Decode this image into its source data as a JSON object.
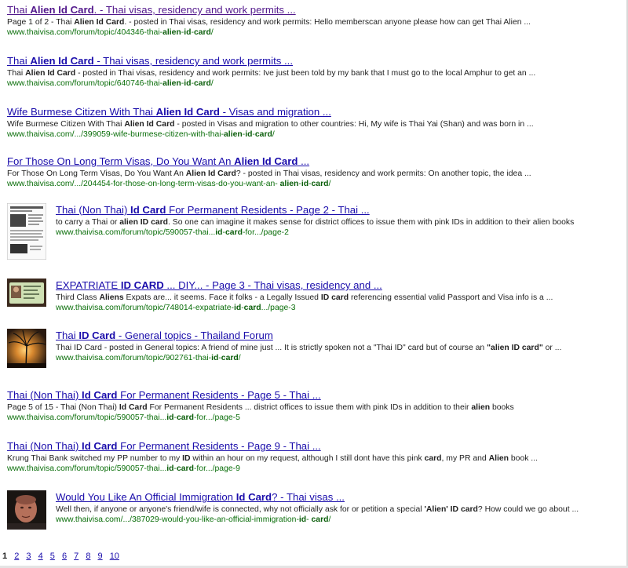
{
  "results": [
    {
      "title": [
        {
          "t": "Thai ",
          "b": false
        },
        {
          "t": "Alien Id Card",
          "b": true
        },
        {
          "t": ". - Thai visas, residency and work permits ...",
          "b": false
        }
      ],
      "visited": true,
      "snippet": [
        {
          "t": "Page 1 of 2 - Thai ",
          "b": false
        },
        {
          "t": "Alien Id Card",
          "b": true
        },
        {
          "t": ". - posted in Thai visas, residency and work permits: Hello memberscan anyone please how can get Thai Alien ...",
          "b": false
        }
      ],
      "url": [
        {
          "t": "www.thaivisa.com/forum/topic/404346-thai-",
          "b": false
        },
        {
          "t": "alien",
          "b": true
        },
        {
          "t": "-",
          "b": false
        },
        {
          "t": "id",
          "b": true
        },
        {
          "t": "-",
          "b": false
        },
        {
          "t": "card",
          "b": true
        },
        {
          "t": "/",
          "b": false
        }
      ]
    },
    {
      "title": [
        {
          "t": "Thai ",
          "b": false
        },
        {
          "t": "Alien Id Card",
          "b": true
        },
        {
          "t": " - Thai visas, residency and work permits ...",
          "b": false
        }
      ],
      "visited": false,
      "snippet": [
        {
          "t": "Thai ",
          "b": false
        },
        {
          "t": "Alien Id Card",
          "b": true
        },
        {
          "t": " - posted in Thai visas, residency and work permits: Ive just been told by my bank that I must go to the local Amphur to get an ...",
          "b": false
        }
      ],
      "url": [
        {
          "t": "www.thaivisa.com/forum/topic/640746-thai-",
          "b": false
        },
        {
          "t": "alien",
          "b": true
        },
        {
          "t": "-",
          "b": false
        },
        {
          "t": "id",
          "b": true
        },
        {
          "t": "-",
          "b": false
        },
        {
          "t": "card",
          "b": true
        },
        {
          "t": "/",
          "b": false
        }
      ]
    },
    {
      "title": [
        {
          "t": "Wife Burmese Citizen With Thai ",
          "b": false
        },
        {
          "t": "Alien Id Card",
          "b": true
        },
        {
          "t": " - Visas and migration ...",
          "b": false
        }
      ],
      "visited": false,
      "snippet": [
        {
          "t": "Wife Burmese Citizen With Thai ",
          "b": false
        },
        {
          "t": "Alien Id Card",
          "b": true
        },
        {
          "t": " - posted in Visas and migration to other countries: Hi, My wife is Thai Yai (Shan) and was born in ...",
          "b": false
        }
      ],
      "url": [
        {
          "t": "www.thaivisa.com/.../399059-wife-burmese-citizen-with-thai-",
          "b": false
        },
        {
          "t": "alien",
          "b": true
        },
        {
          "t": "-",
          "b": false
        },
        {
          "t": "id",
          "b": true
        },
        {
          "t": "-",
          "b": false
        },
        {
          "t": "card",
          "b": true
        },
        {
          "t": "/",
          "b": false
        }
      ]
    },
    {
      "title": [
        {
          "t": "For Those On Long Term Visas, Do You Want An ",
          "b": false
        },
        {
          "t": "Alien Id Card",
          "b": true
        },
        {
          "t": " ...",
          "b": false
        }
      ],
      "visited": false,
      "snippet": [
        {
          "t": "For Those On Long Term Visas, Do You Want An ",
          "b": false
        },
        {
          "t": "Alien Id Card",
          "b": true
        },
        {
          "t": "? - posted in Thai visas, residency and work permits: On another topic, the idea ...",
          "b": false
        }
      ],
      "url": [
        {
          "t": "www.thaivisa.com/.../204454-for-those-on-long-term-visas-do-you-want-an- ",
          "b": false
        },
        {
          "t": "alien",
          "b": true
        },
        {
          "t": "-",
          "b": false
        },
        {
          "t": "id",
          "b": true
        },
        {
          "t": "-",
          "b": false
        },
        {
          "t": "card",
          "b": true
        },
        {
          "t": "/",
          "b": false
        }
      ]
    },
    {
      "thumb": "document",
      "title": [
        {
          "t": "Thai (Non Thai) ",
          "b": false
        },
        {
          "t": "Id Card",
          "b": true
        },
        {
          "t": " For Permanent Residents - Page 2 - Thai ...",
          "b": false
        }
      ],
      "visited": false,
      "snippet": [
        {
          "t": "to carry a Thai or ",
          "b": false
        },
        {
          "t": "alien ID card",
          "b": true
        },
        {
          "t": ". So one can imagine it makes sense for district offices to issue them with pink IDs in addition to their alien books",
          "b": false
        }
      ],
      "url": [
        {
          "t": "www.thaivisa.com/forum/topic/590057-thai...",
          "b": false
        },
        {
          "t": "id",
          "b": true
        },
        {
          "t": "-",
          "b": false
        },
        {
          "t": "card",
          "b": true
        },
        {
          "t": "-for.../page-2",
          "b": false
        }
      ]
    },
    {
      "thumb": "idcard",
      "title": [
        {
          "t": "EXPATRIATE ",
          "b": false
        },
        {
          "t": "ID CARD",
          "b": true
        },
        {
          "t": " ... DIY... - Page 3 - Thai visas, residency and ...",
          "b": false
        }
      ],
      "visited": false,
      "snippet": [
        {
          "t": "Third Class ",
          "b": false
        },
        {
          "t": "Aliens",
          "b": true
        },
        {
          "t": " Expats are... it seems. Face it folks - a Legally Issued ",
          "b": false
        },
        {
          "t": "ID card",
          "b": true
        },
        {
          "t": " referencing essential valid Passport and Visa info is a ...",
          "b": false
        }
      ],
      "url": [
        {
          "t": "www.thaivisa.com/forum/topic/748014-expatriate-",
          "b": false
        },
        {
          "t": "id",
          "b": true
        },
        {
          "t": "-",
          "b": false
        },
        {
          "t": "card",
          "b": true
        },
        {
          "t": ".../page-3",
          "b": false
        }
      ]
    },
    {
      "thumb": "sunset",
      "title": [
        {
          "t": "Thai ",
          "b": false
        },
        {
          "t": "ID Card",
          "b": true
        },
        {
          "t": " - General topics - Thailand Forum",
          "b": false
        }
      ],
      "visited": false,
      "snippet": [
        {
          "t": "Thai ID Card - posted in General topics: A friend of mine just ... It is strictly spoken not a \"Thai ID\" card but of course an ",
          "b": false
        },
        {
          "t": "\"alien ID card\"",
          "b": true
        },
        {
          "t": " or ...",
          "b": false
        }
      ],
      "url": [
        {
          "t": "www.thaivisa.com/forum/topic/902761-thai-",
          "b": false
        },
        {
          "t": "id",
          "b": true
        },
        {
          "t": "-",
          "b": false
        },
        {
          "t": "card",
          "b": true
        },
        {
          "t": "/",
          "b": false
        }
      ]
    },
    {
      "title": [
        {
          "t": "Thai (Non Thai) ",
          "b": false
        },
        {
          "t": "Id Card",
          "b": true
        },
        {
          "t": " For Permanent Residents - Page 5 - Thai ...",
          "b": false
        }
      ],
      "visited": false,
      "snippet": [
        {
          "t": "Page 5 of 15 - Thai (Non Thai) ",
          "b": false
        },
        {
          "t": "Id Card",
          "b": true
        },
        {
          "t": " For Permanent Residents ... district offices to issue them with pink IDs in addition to their ",
          "b": false
        },
        {
          "t": "alien",
          "b": true
        },
        {
          "t": " books",
          "b": false
        }
      ],
      "url": [
        {
          "t": "www.thaivisa.com/forum/topic/590057-thai...",
          "b": false
        },
        {
          "t": "id",
          "b": true
        },
        {
          "t": "-",
          "b": false
        },
        {
          "t": "card",
          "b": true
        },
        {
          "t": "-for.../page-5",
          "b": false
        }
      ]
    },
    {
      "title": [
        {
          "t": "Thai (Non Thai) ",
          "b": false
        },
        {
          "t": "Id Card",
          "b": true
        },
        {
          "t": " For Permanent Residents - Page 9 - Thai ...",
          "b": false
        }
      ],
      "visited": false,
      "snippet": [
        {
          "t": "Krung Thai Bank switched my PP number to my ",
          "b": false
        },
        {
          "t": "ID",
          "b": true
        },
        {
          "t": " within an hour on my request, although I still dont have this pink ",
          "b": false
        },
        {
          "t": "card",
          "b": true
        },
        {
          "t": ", my PR and ",
          "b": false
        },
        {
          "t": "Alien",
          "b": true
        },
        {
          "t": " book ...",
          "b": false
        }
      ],
      "url": [
        {
          "t": "www.thaivisa.com/forum/topic/590057-thai...",
          "b": false
        },
        {
          "t": "id",
          "b": true
        },
        {
          "t": "-",
          "b": false
        },
        {
          "t": "card",
          "b": true
        },
        {
          "t": "-for.../page-9",
          "b": false
        }
      ]
    },
    {
      "thumb": "portrait",
      "title": [
        {
          "t": "Would You Like An Official Immigration ",
          "b": false
        },
        {
          "t": "Id Card",
          "b": true
        },
        {
          "t": "? - Thai visas ...",
          "b": false
        }
      ],
      "visited": false,
      "snippet": [
        {
          "t": "Well then, if anyone or anyone's friend/wife is connected, why not officially ask for or petition a special ",
          "b": false
        },
        {
          "t": "'Alien' ID card",
          "b": true
        },
        {
          "t": "? How could we go about ...",
          "b": false
        }
      ],
      "url": [
        {
          "t": "www.thaivisa.com/.../387029-would-you-like-an-official-immigration-",
          "b": false
        },
        {
          "t": "id",
          "b": true
        },
        {
          "t": "- ",
          "b": false
        },
        {
          "t": "card",
          "b": true
        },
        {
          "t": "/",
          "b": false
        }
      ]
    }
  ],
  "pager": {
    "current": "1",
    "pages": [
      "2",
      "3",
      "4",
      "5",
      "6",
      "7",
      "8",
      "9",
      "10"
    ]
  },
  "colors": {
    "link": "#1a0dab",
    "visited": "#52188c",
    "url": "#0a6e0a",
    "text": "#222222"
  }
}
